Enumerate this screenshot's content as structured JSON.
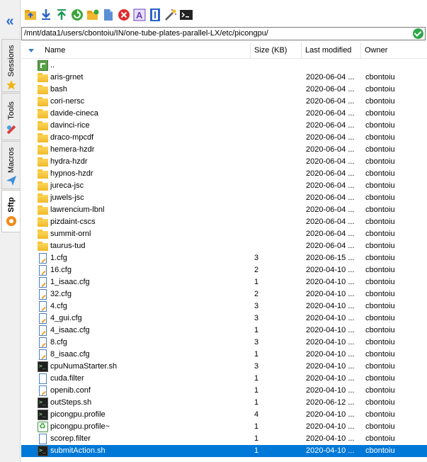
{
  "sidebar": {
    "tabs": [
      {
        "label": "Sessions",
        "icon": "star-icon"
      },
      {
        "label": "Tools",
        "icon": "wrench-icon"
      },
      {
        "label": "Macros",
        "icon": "paper-plane-icon"
      },
      {
        "label": "Sftp",
        "icon": "sftp-icon"
      }
    ]
  },
  "path": "/mnt/data1/users/cbontoiu/IN/one-tube-plates-parallel-LX/etc/picongpu/",
  "columns": {
    "name": "Name",
    "size": "Size (KB)",
    "modified": "Last modified",
    "owner": "Owner"
  },
  "files": [
    {
      "name": "..",
      "size": "",
      "date": "",
      "owner": "",
      "type": "up"
    },
    {
      "name": "aris-grnet",
      "size": "",
      "date": "2020-06-04 ...",
      "owner": "cbontoiu",
      "type": "folder"
    },
    {
      "name": "bash",
      "size": "",
      "date": "2020-06-04 ...",
      "owner": "cbontoiu",
      "type": "folder"
    },
    {
      "name": "cori-nersc",
      "size": "",
      "date": "2020-06-04 ...",
      "owner": "cbontoiu",
      "type": "folder"
    },
    {
      "name": "davide-cineca",
      "size": "",
      "date": "2020-06-04 ...",
      "owner": "cbontoiu",
      "type": "folder"
    },
    {
      "name": "davinci-rice",
      "size": "",
      "date": "2020-06-04 ...",
      "owner": "cbontoiu",
      "type": "folder"
    },
    {
      "name": "draco-mpcdf",
      "size": "",
      "date": "2020-06-04 ...",
      "owner": "cbontoiu",
      "type": "folder"
    },
    {
      "name": "hemera-hzdr",
      "size": "",
      "date": "2020-06-04 ...",
      "owner": "cbontoiu",
      "type": "folder"
    },
    {
      "name": "hydra-hzdr",
      "size": "",
      "date": "2020-06-04 ...",
      "owner": "cbontoiu",
      "type": "folder"
    },
    {
      "name": "hypnos-hzdr",
      "size": "",
      "date": "2020-06-04 ...",
      "owner": "cbontoiu",
      "type": "folder"
    },
    {
      "name": "jureca-jsc",
      "size": "",
      "date": "2020-06-04 ...",
      "owner": "cbontoiu",
      "type": "folder"
    },
    {
      "name": "juwels-jsc",
      "size": "",
      "date": "2020-06-04 ...",
      "owner": "cbontoiu",
      "type": "folder"
    },
    {
      "name": "lawrencium-lbnl",
      "size": "",
      "date": "2020-06-04 ...",
      "owner": "cbontoiu",
      "type": "folder"
    },
    {
      "name": "pizdaint-cscs",
      "size": "",
      "date": "2020-06-04 ...",
      "owner": "cbontoiu",
      "type": "folder"
    },
    {
      "name": "summit-ornl",
      "size": "",
      "date": "2020-06-04 ...",
      "owner": "cbontoiu",
      "type": "folder"
    },
    {
      "name": "taurus-tud",
      "size": "",
      "date": "2020-06-04 ...",
      "owner": "cbontoiu",
      "type": "folder"
    },
    {
      "name": "1.cfg",
      "size": "3",
      "date": "2020-06-15 ...",
      "owner": "cbontoiu",
      "type": "file"
    },
    {
      "name": "16.cfg",
      "size": "2",
      "date": "2020-04-10 ...",
      "owner": "cbontoiu",
      "type": "file"
    },
    {
      "name": "1_isaac.cfg",
      "size": "1",
      "date": "2020-04-10 ...",
      "owner": "cbontoiu",
      "type": "file"
    },
    {
      "name": "32.cfg",
      "size": "2",
      "date": "2020-04-10 ...",
      "owner": "cbontoiu",
      "type": "file"
    },
    {
      "name": "4.cfg",
      "size": "3",
      "date": "2020-04-10 ...",
      "owner": "cbontoiu",
      "type": "file"
    },
    {
      "name": "4_gui.cfg",
      "size": "3",
      "date": "2020-04-10 ...",
      "owner": "cbontoiu",
      "type": "file"
    },
    {
      "name": "4_isaac.cfg",
      "size": "1",
      "date": "2020-04-10 ...",
      "owner": "cbontoiu",
      "type": "file"
    },
    {
      "name": "8.cfg",
      "size": "3",
      "date": "2020-04-10 ...",
      "owner": "cbontoiu",
      "type": "file"
    },
    {
      "name": "8_isaac.cfg",
      "size": "1",
      "date": "2020-04-10 ...",
      "owner": "cbontoiu",
      "type": "file"
    },
    {
      "name": "cpuNumaStarter.sh",
      "size": "3",
      "date": "2020-04-10 ...",
      "owner": "cbontoiu",
      "type": "term"
    },
    {
      "name": "cuda.filter",
      "size": "1",
      "date": "2020-04-10 ...",
      "owner": "cbontoiu",
      "type": "doc"
    },
    {
      "name": "openib.conf",
      "size": "1",
      "date": "2020-04-10 ...",
      "owner": "cbontoiu",
      "type": "file"
    },
    {
      "name": "outSteps.sh",
      "size": "1",
      "date": "2020-06-12 ...",
      "owner": "cbontoiu",
      "type": "term"
    },
    {
      "name": "picongpu.profile",
      "size": "4",
      "date": "2020-04-10 ...",
      "owner": "cbontoiu",
      "type": "term"
    },
    {
      "name": "picongpu.profile~",
      "size": "1",
      "date": "2020-04-10 ...",
      "owner": "cbontoiu",
      "type": "recycle"
    },
    {
      "name": "scorep.filter",
      "size": "1",
      "date": "2020-04-10 ...",
      "owner": "cbontoiu",
      "type": "doc"
    },
    {
      "name": "submitAction.sh",
      "size": "1",
      "date": "2020-04-10 ...",
      "owner": "cbontoiu",
      "type": "term",
      "selected": true
    }
  ],
  "toolbar": [
    {
      "icon": "parent-folder-icon",
      "color": "#e8a21a"
    },
    {
      "icon": "download-icon",
      "color": "#2a62c9"
    },
    {
      "icon": "upload-icon",
      "color": "#1e9a5a"
    },
    {
      "icon": "refresh-icon",
      "color": "#3aa63a"
    },
    {
      "icon": "new-folder-icon",
      "color": "#f1b72f"
    },
    {
      "icon": "new-file-icon",
      "color": "#5a8fd6"
    },
    {
      "icon": "delete-icon",
      "color": "#e02c2c"
    },
    {
      "icon": "rename-icon",
      "color": "#6a3fc2"
    },
    {
      "icon": "edit-icon",
      "color": "#2a62c9"
    },
    {
      "icon": "magic-wand-icon",
      "color": "#c06ad6"
    },
    {
      "icon": "terminal-icon",
      "color": "#222222"
    }
  ]
}
